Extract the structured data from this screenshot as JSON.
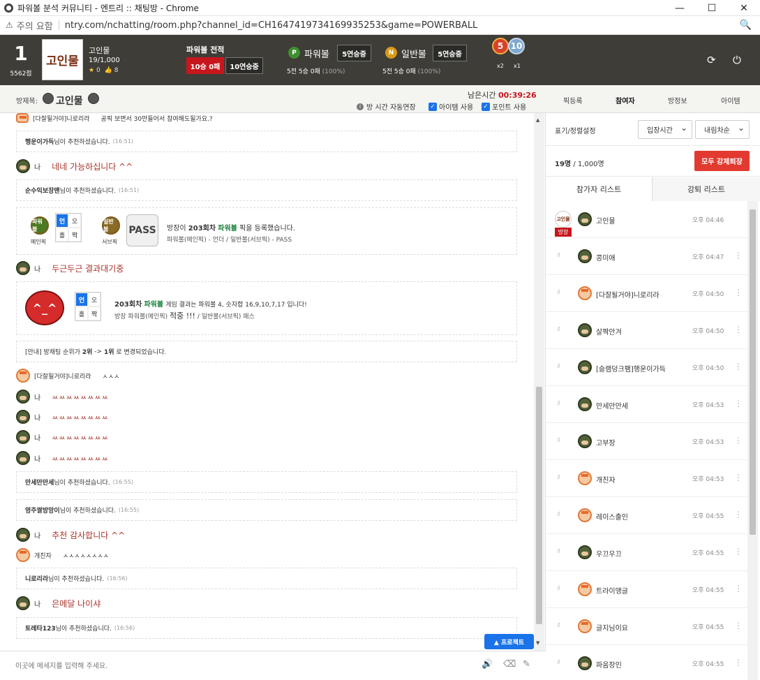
{
  "window": {
    "title": "파워볼 분석 커뮤니티 - 엔트리 :: 채팅방 - Chrome",
    "minimize": "—",
    "maximize": "☐",
    "close": "✕"
  },
  "address": {
    "warning": "주의 요함",
    "url": "ntry.com/nchatting/room.php?channel_id=CH1647419734169935253&game=POWERBALL"
  },
  "header": {
    "rank": "1",
    "points": "5562점",
    "avatar_text": "고인물",
    "user_name": "고인물",
    "user_count": "19/1,000",
    "stars": "0",
    "likes": "8",
    "record_title": "파워볼 전적",
    "record_loss": "10승 0패",
    "record_streak": "10연승중",
    "powerball": {
      "label": "파워볼",
      "badge": "P",
      "streak": "5연승중",
      "summary": "5전 5승 0패",
      "pct": "(100%)"
    },
    "normalball": {
      "label": "일반볼",
      "badge": "N",
      "streak": "5연승중",
      "summary": "5전 5승 0패",
      "pct": "(100%)"
    },
    "medals": [
      {
        "num": "5",
        "count": "x2"
      },
      {
        "num": "10",
        "count": "x1"
      }
    ]
  },
  "subbar": {
    "room_label": "방제목:",
    "room_name": "고인물",
    "remain_label": "남은시간",
    "remain_time": "00:39:26",
    "auto_extend": "방 시간 자동연장",
    "use_item": "아이템 사용",
    "use_point": "포인트 사용",
    "tabs": [
      "픽등록",
      "참여자",
      "방정보",
      "아이템"
    ]
  },
  "chat": {
    "top_nick": "[다잘될거야]니로리라",
    "top_msg": "공픽 보면서 30만들어서 참여해도될가요.?",
    "sys1": {
      "name": "행운이가득",
      "text": "님이 추천하셨습니다.",
      "time": "(16:51)"
    },
    "me_label": "나",
    "me1": "네네 가능하십니다 ^^",
    "sys2": {
      "name": "순수익보장맨",
      "text": "님이 추천하셨습니다.",
      "time": "(16:51)"
    },
    "pick": {
      "main_ball": "파워볼",
      "main_label": "메인픽",
      "sub_ball": "일반볼",
      "sub_label": "서브픽",
      "grid": [
        "언",
        "오",
        "홀",
        "짝"
      ],
      "pass": "PASS",
      "line1_a": "방장이",
      "line1_round": "203회차",
      "line1_game": "파워볼",
      "line1_b": "픽을 등록했습니다.",
      "line2": "파워볼(메인픽) - 언더 / 일반볼(서브픽) - PASS"
    },
    "me2": "두근두근 결과대기중",
    "result": {
      "devil": "^_^",
      "round": "203회차",
      "game": "파워볼",
      "line1": "게임 결과는 파워볼 4, 숫자합 16,9,10,7,17 입니다!",
      "line2_a": "방장 파워볼(메인픽)",
      "hit": "적중 !!!",
      "line2_b": "/ 일반볼(서브픽) 패스"
    },
    "notice": {
      "a": "[안내] 방채팅 순위가",
      "from": "2위",
      "arrow": "->",
      "to": "1위",
      "b": "로 변경되었습니다."
    },
    "nick2": "[다잘될거야]니로리라",
    "msg2": "ㅅㅅㅅ",
    "me_k": [
      "ㅆㅆㅆㅆㅆㅆㅆㅆ",
      "ㅆㅆㅆㅆㅆㅆㅆㅆ",
      "ㅆㅆㅆㅆㅆㅆㅆㅆ",
      "ㅆㅆㅆㅆㅆㅆㅆㅆ"
    ],
    "sys3": {
      "name": "만세만만세",
      "text": "님이 추천하셨습니다.",
      "time": "(16:55)"
    },
    "sys4": {
      "name": "영주쌀방망이",
      "text": "님이 추천하셨습니다.",
      "time": "(16:55)"
    },
    "me3": "추천 감사합니다 ^^",
    "nick3": "개친자",
    "msg3": "ㅅㅅㅅㅅㅅㅅㅅㅅ",
    "sys5": {
      "name": "니로리라",
      "text": "님이 추천하셨습니다.",
      "time": "(16:56)"
    },
    "me4": "은메달 나이샤",
    "sys6": {
      "name": "토레타123",
      "text": "님이 추천하셨습니다.",
      "time": "(16:56)"
    },
    "protect": "▲ 프로젝트",
    "input_placeholder": "이곳에 메세지를 입력해 주세요."
  },
  "side": {
    "sort_label": "표기/정렬설정",
    "sort1": "입장시간",
    "sort2": "내림차순",
    "count": "19명",
    "count_total": "/ 1,000명",
    "kick_all": "모두 강제퇴장",
    "tab_participants": "참가자 리스트",
    "tab_kicked": "강퇴 리스트",
    "host_badge": "방장",
    "users": [
      {
        "nick": "고인물",
        "time": "오후 04:46",
        "host": true,
        "av": "g"
      },
      {
        "nick": "콩미애",
        "time": "오후 04:47",
        "av": "g"
      },
      {
        "nick": "[다잘될거야]니로리라",
        "time": "오후 04:50",
        "av": "c"
      },
      {
        "nick": "살짝안겨",
        "time": "오후 04:50",
        "av": "g"
      },
      {
        "nick": "[슬램덩크팸]행운이가득",
        "time": "오후 04:50",
        "av": "g"
      },
      {
        "nick": "만세만만세",
        "time": "오후 04:53",
        "av": "g"
      },
      {
        "nick": "고부장",
        "time": "오후 04:53",
        "av": "g"
      },
      {
        "nick": "개친자",
        "time": "오후 04:53",
        "av": "c"
      },
      {
        "nick": "레이스출인",
        "time": "오후 04:55",
        "av": "c"
      },
      {
        "nick": "우끄우끄",
        "time": "오후 04:55",
        "av": "g"
      },
      {
        "nick": "트라이앵글",
        "time": "오후 04:55",
        "av": "c"
      },
      {
        "nick": "글지님이요",
        "time": "오후 04:55",
        "av": "c"
      },
      {
        "nick": "파움장인",
        "time": "오후 04:55",
        "av": "g"
      }
    ]
  },
  "colors": {
    "header": "#3e3d38",
    "accent_red": "#c8161d",
    "blue": "#1a73e8",
    "chat_me": "#a8322a"
  }
}
